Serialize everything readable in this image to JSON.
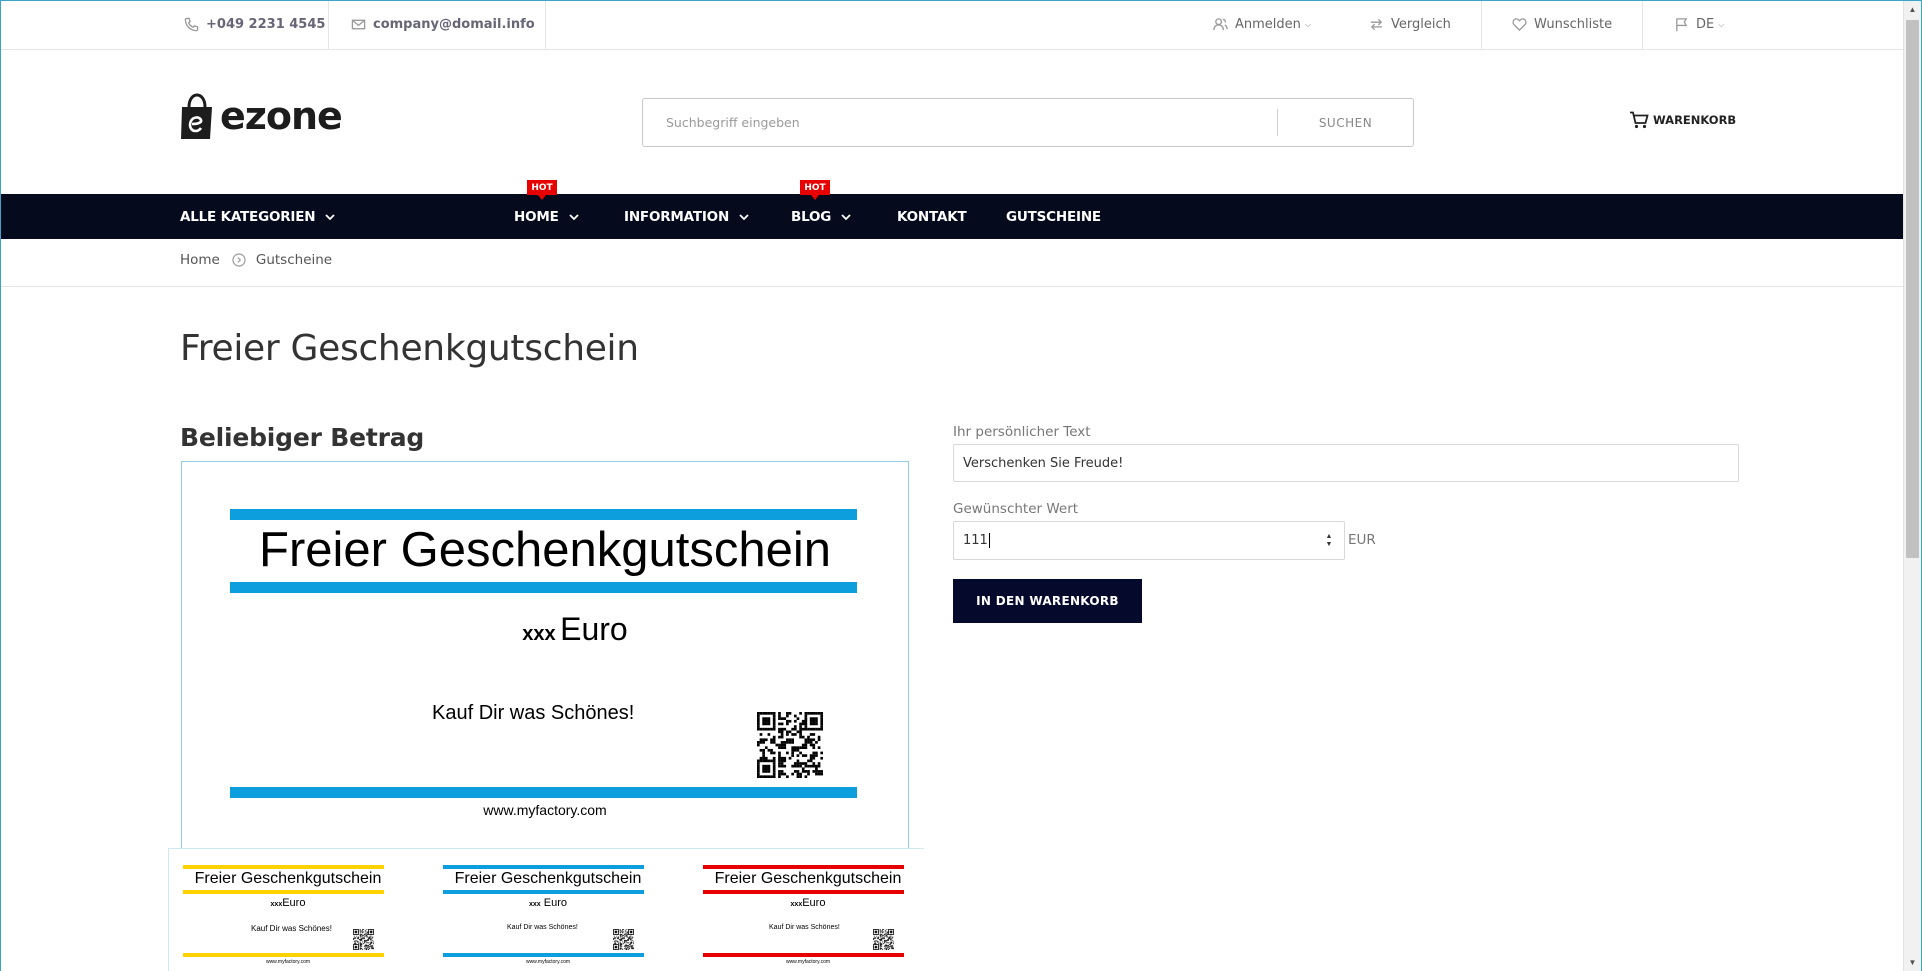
{
  "topbar": {
    "phone": "+049 2231 4545",
    "email": "company@domail.info",
    "login": "Anmelden",
    "compare": "Vergleich",
    "wishlist": "Wunschliste",
    "language": "DE"
  },
  "header": {
    "logo_text": "ezone",
    "search_placeholder": "Suchbegriff eingeben",
    "search_button": "SUCHEN",
    "cart_label": "WARENKORB"
  },
  "nav": {
    "all_categories": "ALLE KATEGORIEN",
    "items": [
      {
        "label": "HOME",
        "badge": "HOT"
      },
      {
        "label": "INFORMATION",
        "badge": ""
      },
      {
        "label": "BLOG",
        "badge": "HOT"
      },
      {
        "label": "KONTAKT",
        "badge": ""
      },
      {
        "label": "GUTSCHEINE",
        "badge": ""
      }
    ]
  },
  "breadcrumb": {
    "home": "Home",
    "current": "Gutscheine"
  },
  "main": {
    "page_title": "Freier Geschenkgutschein",
    "product_title": "Beliebiger Betrag",
    "voucher": {
      "title": "Freier Geschenkgutschein",
      "amount_placeholder": "xxx",
      "currency_word": "Euro",
      "tagline": "Kauf Dir was Schönes!",
      "url": "www.myfactory.com",
      "accent": "#0d9ede"
    },
    "thumbnails": [
      {
        "title": "Freier Geschenkgutschein",
        "amount_placeholder": "xxx",
        "currency_word": "Euro",
        "tagline": "Kauf Dir was Schönes!",
        "url": "www.myfactory.com",
        "color": "#ffd200"
      },
      {
        "title": "Freier Geschenkgutschein",
        "amount_placeholder": "xxx",
        "currency_word": "Euro",
        "tagline": "Kauf Dir was Schönes!",
        "url": "www.myfactory.com",
        "color": "#0d9ede"
      },
      {
        "title": "Freier Geschenkgutschein",
        "amount_placeholder": "xxx",
        "currency_word": "Euro",
        "tagline": "Kauf Dir was Schönes!",
        "url": "www.myfactory.com",
        "color": "#e60000"
      }
    ]
  },
  "form": {
    "text_label": "Ihr persönlicher Text",
    "text_value": "Verschenken Sie Freude!",
    "value_label": "Gewünschter Wert",
    "value_current": "111",
    "unit": "EUR",
    "add_to_cart": "IN DEN WARENKORB"
  }
}
